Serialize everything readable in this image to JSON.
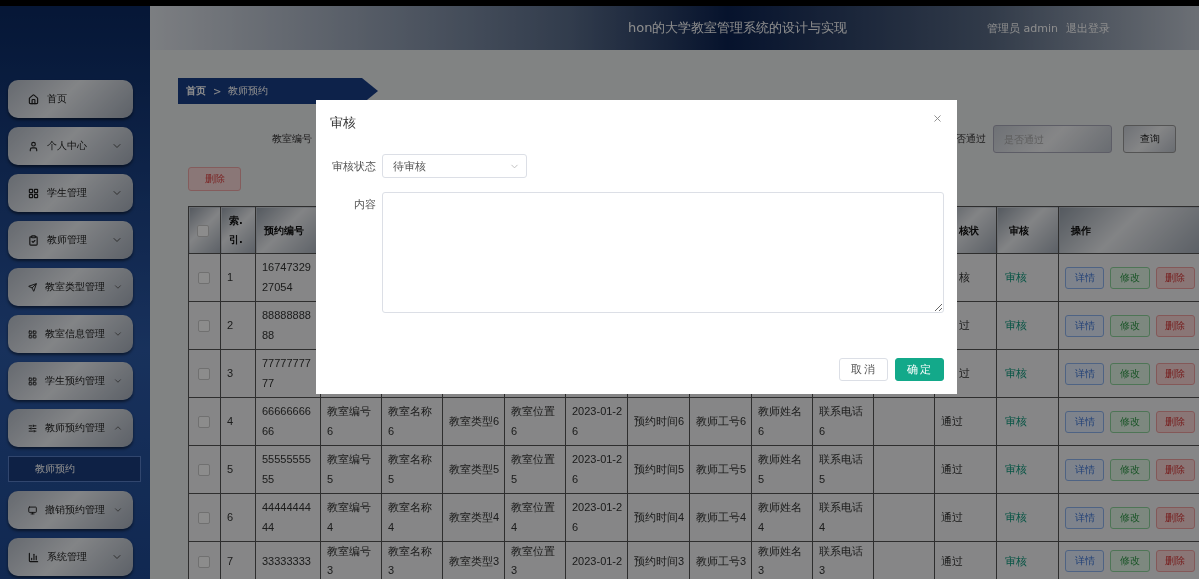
{
  "header": {
    "title": "hon的大学教室管理系统的设计与实现",
    "user": "管理员 admin",
    "logout": "退出登录"
  },
  "sidebar": {
    "items": [
      {
        "label": "首页"
      },
      {
        "label": "个人中心",
        "expanded": false
      },
      {
        "label": "学生管理",
        "expanded": false
      },
      {
        "label": "教师管理",
        "expanded": false
      },
      {
        "label": "教室类型管理",
        "expanded": false
      },
      {
        "label": "教室信息管理",
        "expanded": false
      },
      {
        "label": "学生预约管理",
        "expanded": false
      },
      {
        "label": "教师预约管理",
        "expanded": true,
        "children": [
          {
            "label": "教师预约",
            "selected": true
          }
        ]
      },
      {
        "label": "撤销预约管理",
        "expanded": false
      },
      {
        "label": "系统管理",
        "expanded": false
      }
    ]
  },
  "breadcrumb": {
    "items": [
      "首页",
      "教师预约"
    ],
    "separator": ">"
  },
  "search": {
    "label": "教室编号",
    "filter_label": "否通过",
    "filter_placeholder": "是否通过",
    "button": "查询"
  },
  "delete_button": "删除",
  "table": {
    "select_all_checked": false,
    "columns": {
      "index": "索.引.",
      "number": "预约编号",
      "status": "核状",
      "review": "审核",
      "actions": "操作"
    },
    "rows": [
      {
        "checked": false,
        "index": "1",
        "number": "1674732927054",
        "status": "核",
        "review": "审核",
        "actions": [
          "详情",
          "修改",
          "删除"
        ]
      },
      {
        "checked": false,
        "index": "2",
        "number": "8888888888",
        "status": "过",
        "review": "审核",
        "actions": [
          "详情",
          "修改",
          "删除"
        ]
      },
      {
        "checked": false,
        "index": "3",
        "number": "7777777777",
        "status": "过",
        "review": "审核",
        "actions": [
          "详情",
          "修改",
          "删除"
        ]
      },
      {
        "checked": false,
        "index": "4",
        "number": "6666666666",
        "cells": [
          "教室编号6",
          "教室名称6",
          "教室类型6",
          "教室位置6",
          "2023-01-26",
          "预约时间6",
          "教师工号6",
          "教师姓名6",
          "联系电话6"
        ],
        "status": "通过",
        "review": "审核",
        "actions": [
          "详情",
          "修改",
          "删除"
        ]
      },
      {
        "checked": false,
        "index": "5",
        "number": "5555555555",
        "cells": [
          "教室编号5",
          "教室名称5",
          "教室类型5",
          "教室位置5",
          "2023-01-26",
          "预约时间5",
          "教师工号5",
          "教师姓名5",
          "联系电话5"
        ],
        "status": "通过",
        "review": "审核",
        "actions": [
          "详情",
          "修改",
          "删除"
        ]
      },
      {
        "checked": false,
        "index": "6",
        "number": "4444444444",
        "cells": [
          "教室编号4",
          "教室名称4",
          "教室类型4",
          "教室位置4",
          "2023-01-26",
          "预约时间4",
          "教师工号4",
          "教师姓名4",
          "联系电话4"
        ],
        "status": "通过",
        "review": "审核",
        "actions": [
          "详情",
          "修改",
          "删除"
        ]
      },
      {
        "checked": false,
        "index": "7",
        "number": "33333333",
        "cells": [
          "教室编号3",
          "教室名称3",
          "教室类型3",
          "教室位置3",
          "2023-01-2",
          "预约时间3",
          "教师工号3",
          "教师姓名3",
          "联系电话3"
        ],
        "status": "通过",
        "review": "审核",
        "actions": [
          "详情",
          "修改",
          "删除"
        ]
      }
    ]
  },
  "dialog": {
    "title": "审核",
    "fields": [
      {
        "kind": "select",
        "label": "审核状态",
        "value": "待审核"
      },
      {
        "kind": "textarea",
        "label": "内容"
      }
    ],
    "buttons": [
      {
        "kind": "default",
        "label": "取消"
      },
      {
        "kind": "primary",
        "label": "确定"
      }
    ]
  }
}
